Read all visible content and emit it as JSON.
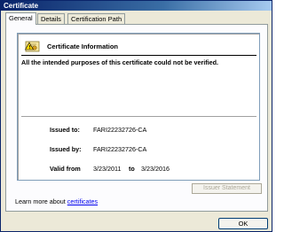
{
  "window": {
    "title": "Certificate"
  },
  "tabs": [
    {
      "label": "General",
      "active": true
    },
    {
      "label": "Details",
      "active": false
    },
    {
      "label": "Certification Path",
      "active": false
    }
  ],
  "info": {
    "title": "Certificate Information",
    "warning": "All the intended purposes of this certificate could not be verified."
  },
  "fields": {
    "issued_to_label": "Issued to:",
    "issued_to_value": "FARI22232726-CA",
    "issued_by_label": "Issued by:",
    "issued_by_value": "FARI22232726-CA",
    "valid_from_label": "Valid from",
    "valid_from_value": "3/23/2011",
    "valid_to_label": "to",
    "valid_to_value": "3/23/2016"
  },
  "buttons": {
    "issuer_statement": "Issuer Statement",
    "ok": "OK"
  },
  "learn_more": {
    "prefix": "Learn more about ",
    "link": "certificates"
  },
  "icons": {
    "certificate": "certificate-warning-icon"
  },
  "colors": {
    "title_bar": "#0a246a",
    "link": "#0000ee",
    "disabled_text": "#aca899"
  }
}
